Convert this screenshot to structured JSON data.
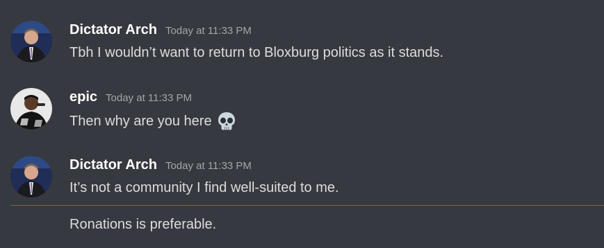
{
  "messages": [
    {
      "author": "Dictator Arch",
      "timestamp": "Today at 11:33 PM",
      "text": "Tbh I wouldn’t want to return to Bloxburg politics as it stands."
    },
    {
      "author": "epic",
      "timestamp": "Today at 11:33 PM",
      "text": "Then why are you here",
      "emoji": "skull-emoji"
    },
    {
      "author": "Dictator Arch",
      "timestamp": "Today at 11:33 PM",
      "text": "It’s not a community I find well-suited to me."
    }
  ],
  "followup": {
    "text": "Ronations is preferable."
  },
  "colors": {
    "background": "#36393f",
    "username": "#ffffff",
    "timestamp": "#a3a6aa",
    "message_text": "#dcddde",
    "new_messages_divider": "#d5393f"
  }
}
